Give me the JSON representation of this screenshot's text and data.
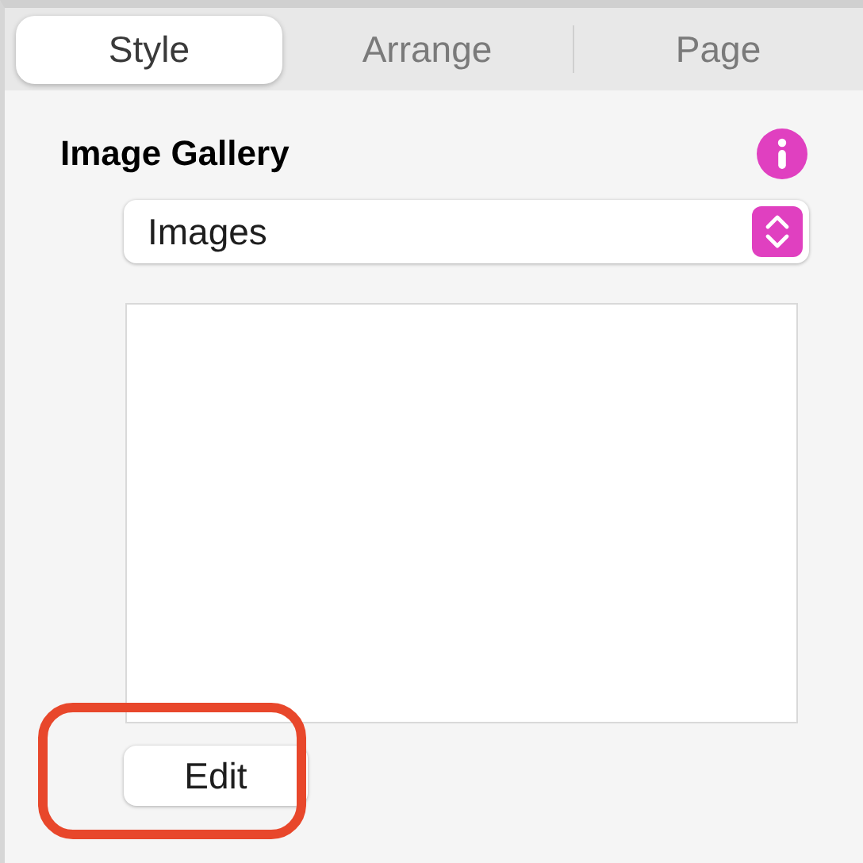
{
  "tabs": [
    {
      "label": "Style",
      "selected": true
    },
    {
      "label": "Arrange",
      "selected": false
    },
    {
      "label": "Page",
      "selected": false
    }
  ],
  "section": {
    "title": "Image Gallery"
  },
  "source_select": {
    "value": "Images"
  },
  "edit_button": {
    "label": "Edit",
    "highlighted": true
  }
}
